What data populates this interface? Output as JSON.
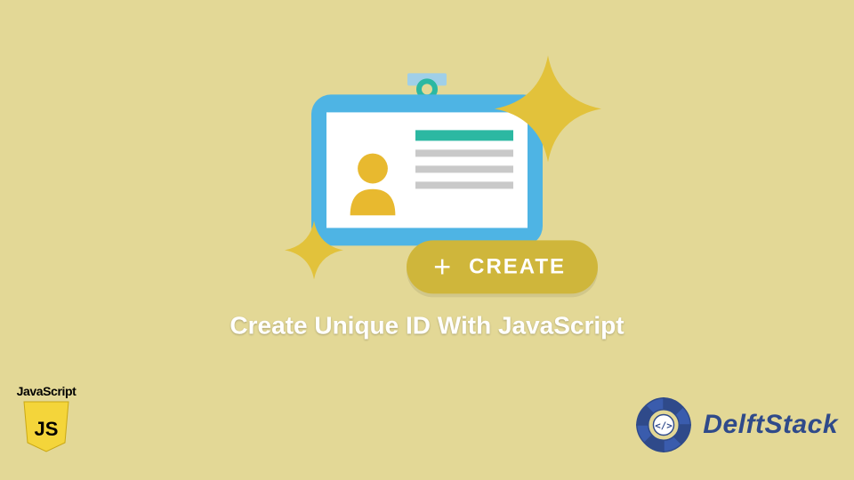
{
  "headline": "Create Unique ID With JavaScript",
  "create_button": {
    "icon_label": "+",
    "label": "CREATE"
  },
  "js_logo": {
    "label": "JavaScript",
    "shield_text": "JS"
  },
  "brand": {
    "name": "DelftStack",
    "badge_glyph": "</>"
  },
  "colors": {
    "bg": "#e3d896",
    "card": "#4eb4e4",
    "accent_teal": "#2cb8a2",
    "pill": "#cfb63b",
    "mustard": "#e2c23b",
    "yellow": "#f4d53a",
    "brand_blue": "#2f4a8a"
  }
}
